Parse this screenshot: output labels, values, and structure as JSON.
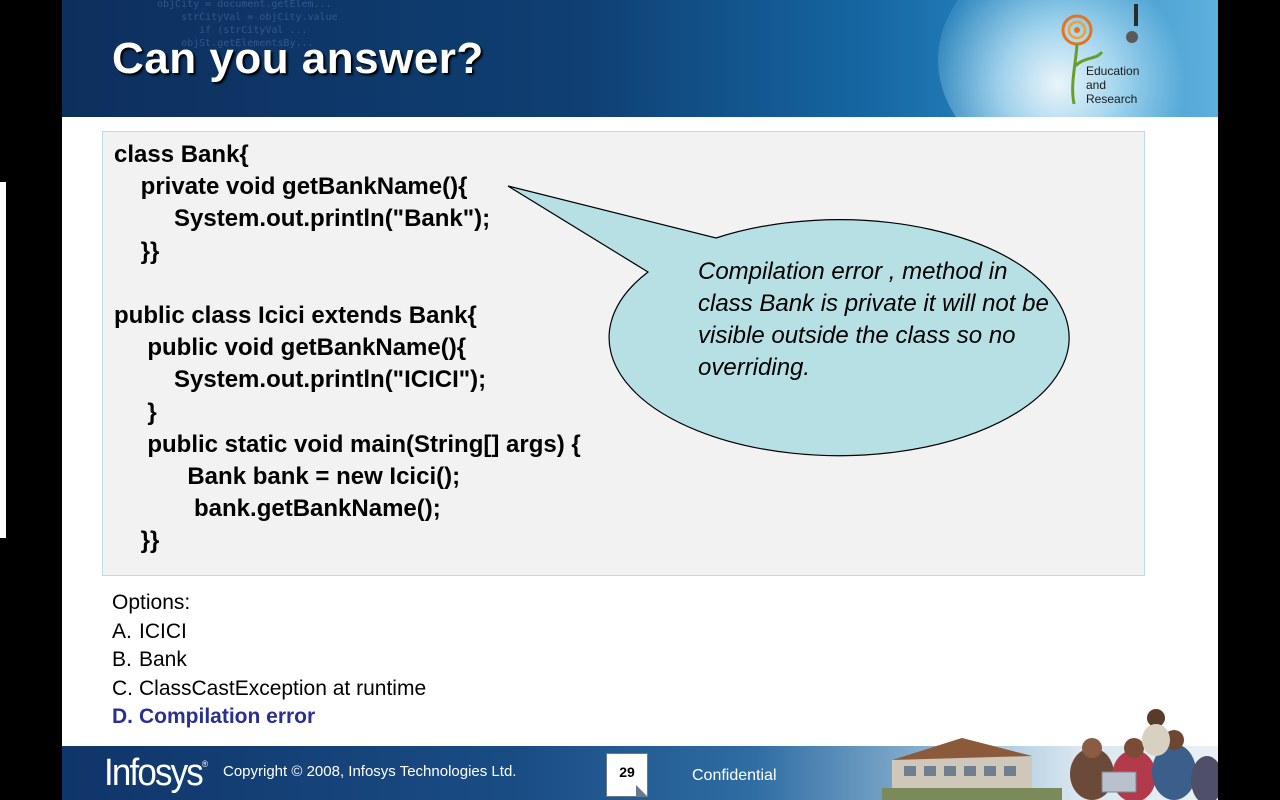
{
  "header": {
    "title": "Can you answer?",
    "logo_text": [
      "Education",
      "and",
      "Research"
    ]
  },
  "code_lines": [
    "class Bank{",
    "    private void getBankName(){",
    "         System.out.println(\"Bank\");",
    "    }}",
    "",
    "public class Icici extends Bank{",
    "     public void getBankName(){",
    "         System.out.println(\"ICICI\");",
    "     }",
    "     public static void main(String[] args) {",
    "           Bank bank = new Icici();",
    "            bank.getBankName();",
    "    }}"
  ],
  "callout": {
    "text": "Compilation error , method in class Bank  is private it will not be visible outside the class so no overriding."
  },
  "options": {
    "label": "Options:",
    "items": [
      {
        "letter": "A.",
        "text": "ICICI"
      },
      {
        "letter": "B.",
        "text": "Bank"
      },
      {
        "letter": "C.",
        "text": "ClassCastException at runtime"
      },
      {
        "letter": "D.",
        "text": "Compilation error"
      }
    ],
    "correct_color": "#2b2f8f"
  },
  "footer": {
    "brand": "Infosys",
    "copyright": "Copyright © 2008, Infosys  Technologies  Ltd.",
    "page_number": "29",
    "confidential": "Confidential"
  }
}
